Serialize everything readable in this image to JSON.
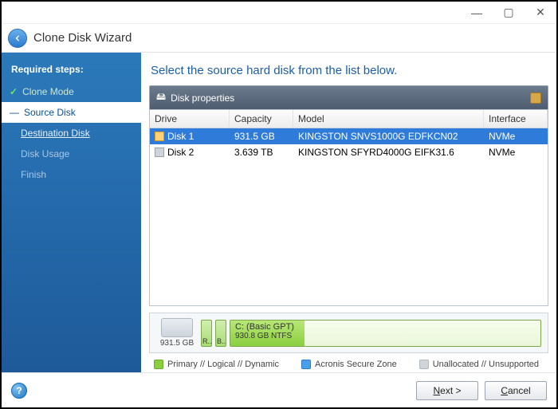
{
  "window": {
    "title": "Clone Disk Wizard"
  },
  "sidebar": {
    "heading": "Required steps:",
    "steps": [
      {
        "label": "Clone Mode",
        "state": "completed"
      },
      {
        "label": "Source Disk",
        "state": "current"
      },
      {
        "label": "Destination Disk",
        "state": "link"
      },
      {
        "label": "Disk Usage",
        "state": "dim"
      },
      {
        "label": "Finish",
        "state": "dim"
      }
    ]
  },
  "main": {
    "instruction": "Select the source hard disk from the list below.",
    "panel_title": "Disk properties",
    "columns": {
      "drive": "Drive",
      "capacity": "Capacity",
      "model": "Model",
      "interface": "Interface"
    },
    "disks": [
      {
        "drive": "Disk 1",
        "capacity": "931.5 GB",
        "model": "KINGSTON SNVS1000G EDFKCN02",
        "interface": "NVMe",
        "selected": true
      },
      {
        "drive": "Disk 2",
        "capacity": "3.639 TB",
        "model": "KINGSTON SFYRD4000G EIFK31.6",
        "interface": "NVMe",
        "selected": false
      }
    ],
    "partition_bar": {
      "total": "931.5 GB",
      "small1": "R...",
      "small2": "B...",
      "main_label": "C: (Basic GPT)",
      "main_sub": "930.8 GB  NTFS"
    },
    "legend": {
      "primary": "Primary // Logical // Dynamic",
      "secure": "Acronis Secure Zone",
      "unalloc": "Unallocated // Unsupported"
    }
  },
  "footer": {
    "next": "Next >",
    "cancel": "Cancel"
  }
}
